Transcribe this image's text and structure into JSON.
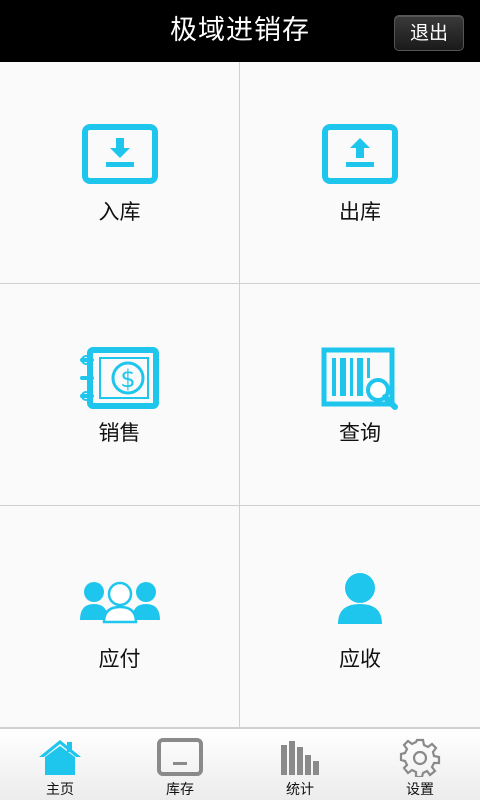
{
  "header": {
    "title": "极域进销存",
    "exit_label": "退出"
  },
  "tiles": [
    {
      "label": "入库",
      "icon": "inbound-icon"
    },
    {
      "label": "出库",
      "icon": "outbound-icon"
    },
    {
      "label": "销售",
      "icon": "sales-ledger-icon"
    },
    {
      "label": "查询",
      "icon": "barcode-search-icon"
    },
    {
      "label": "应付",
      "icon": "group-people-icon"
    },
    {
      "label": "应收",
      "icon": "person-icon"
    }
  ],
  "bottom_nav": [
    {
      "label": "主页",
      "icon": "home-icon",
      "active": true
    },
    {
      "label": "库存",
      "icon": "inventory-icon",
      "active": false
    },
    {
      "label": "统计",
      "icon": "bar-chart-icon",
      "active": false
    },
    {
      "label": "设置",
      "icon": "gear-icon",
      "active": false
    }
  ],
  "colors": {
    "accent": "#1ec6ee",
    "inactive_icon": "#8a8a8a",
    "header_bg": "#000000"
  }
}
